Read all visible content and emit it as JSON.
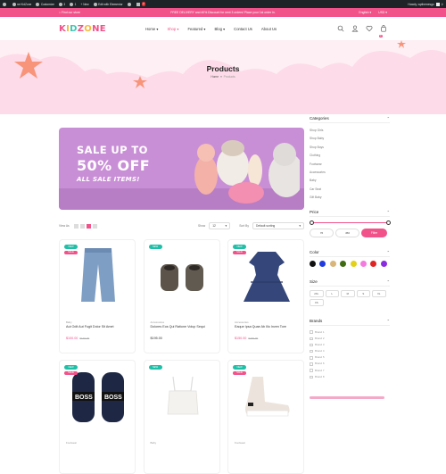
{
  "admin_bar": {
    "items": [
      {
        "icon": "wordpress-icon",
        "label": ""
      },
      {
        "icon": "home-icon",
        "label": "ne KidZone"
      },
      {
        "icon": "brush-icon",
        "label": "Customize"
      },
      {
        "icon": "update-icon",
        "label": "3"
      },
      {
        "icon": "comment-icon",
        "label": "1"
      },
      {
        "icon": "plus-icon",
        "label": "New"
      },
      {
        "icon": "elementor-icon",
        "label": "Edit with Elementor"
      },
      {
        "icon": "puzzle-icon",
        "label": ""
      },
      {
        "icon": "plugin-icon",
        "label": ""
      }
    ],
    "badge_count": "2",
    "greeting": "Howdy, wpthemesgo"
  },
  "topbar": {
    "find_store": "Find our store",
    "promo": "FREE DELIVERY and 40% Discount for next 3 orders! Place your 1st order in.",
    "language": "English",
    "currency": "USD"
  },
  "header": {
    "logo_letters": [
      "K",
      "I",
      "D",
      "Z",
      "O",
      "N",
      "E"
    ],
    "nav": [
      {
        "label": "Home",
        "dropdown": true,
        "active": false
      },
      {
        "label": "Shop",
        "dropdown": true,
        "active": true
      },
      {
        "label": "Featured",
        "dropdown": true,
        "active": false
      },
      {
        "label": "Blog",
        "dropdown": true,
        "active": false
      },
      {
        "label": "Contact Us",
        "dropdown": false,
        "active": false
      },
      {
        "label": "About Us",
        "dropdown": false,
        "active": false
      }
    ],
    "cart_count": "0"
  },
  "hero": {
    "title": "Products",
    "breadcrumb": {
      "home": "Home",
      "separator": "»",
      "current": "Products"
    }
  },
  "banner": {
    "line1": "SALE UP TO",
    "line2": "50% OFF",
    "line3": "ALL SALE ITEMS!"
  },
  "toolbar": {
    "view_as_label": "View As",
    "show_label": "Show",
    "show_value": "12",
    "sort_label": "Sort By",
    "sort_value": "Default sorting"
  },
  "products": [
    {
      "category": "Baby",
      "title": "Aut Odit Aut Fugit Dolor Sit Amet",
      "price": "$100.00",
      "old_price": "$130.00",
      "tags": [
        "NEW",
        "SALE"
      ],
      "image": "jeans"
    },
    {
      "category": "Accessories",
      "title": "Dolores Eos Qui Ratione Volup Sequi",
      "price": "$195.00",
      "old_price": "",
      "tags": [
        "NEW"
      ],
      "image": "booties"
    },
    {
      "category": "Accessories",
      "title": "Eaque Ipsa Quae Ab Illo Inven Tore",
      "price": "$150.00",
      "old_price": "$245.00",
      "tags": [
        "NEW",
        "SALE"
      ],
      "image": "dress"
    },
    {
      "category": "Footwear",
      "title": "",
      "price": "",
      "old_price": "",
      "tags": [
        "NEW",
        "SALE"
      ],
      "image": "sneakers"
    },
    {
      "category": "Baby",
      "title": "",
      "price": "",
      "old_price": "",
      "tags": [
        "NEW"
      ],
      "image": "crop-top"
    },
    {
      "category": "Footwear",
      "title": "",
      "price": "",
      "old_price": "",
      "tags": [
        "NEW",
        "SALE"
      ],
      "image": "sock-sneaker"
    }
  ],
  "sidebar": {
    "categories": {
      "title": "Categories",
      "items": [
        "Shop Girls",
        "Shop Baby",
        "Shop Boys",
        "Clothing",
        "Footwear",
        "Accessories",
        "Baby",
        "Car Seat",
        "Gift Baby"
      ]
    },
    "price": {
      "title": "Price",
      "min": "76",
      "max": "450",
      "filter_label": "Filter",
      "range_fraction": [
        0,
        1
      ]
    },
    "color": {
      "title": "Color",
      "swatches": [
        "#111111",
        "#1f3be0",
        "#d9b57a",
        "#3f6b12",
        "#e4d016",
        "#f57ae0",
        "#e02424",
        "#8a2be2"
      ]
    },
    "size": {
      "title": "Size",
      "options": [
        "2XL",
        "L",
        "M",
        "S",
        "XL",
        "XS"
      ]
    },
    "brands": {
      "title": "Brands",
      "items": [
        "Brand 1",
        "Brand 2",
        "Brand 3",
        "Brand 4",
        "Brand 5",
        "Brand 6",
        "Brand 7",
        "Brand 8"
      ]
    }
  }
}
